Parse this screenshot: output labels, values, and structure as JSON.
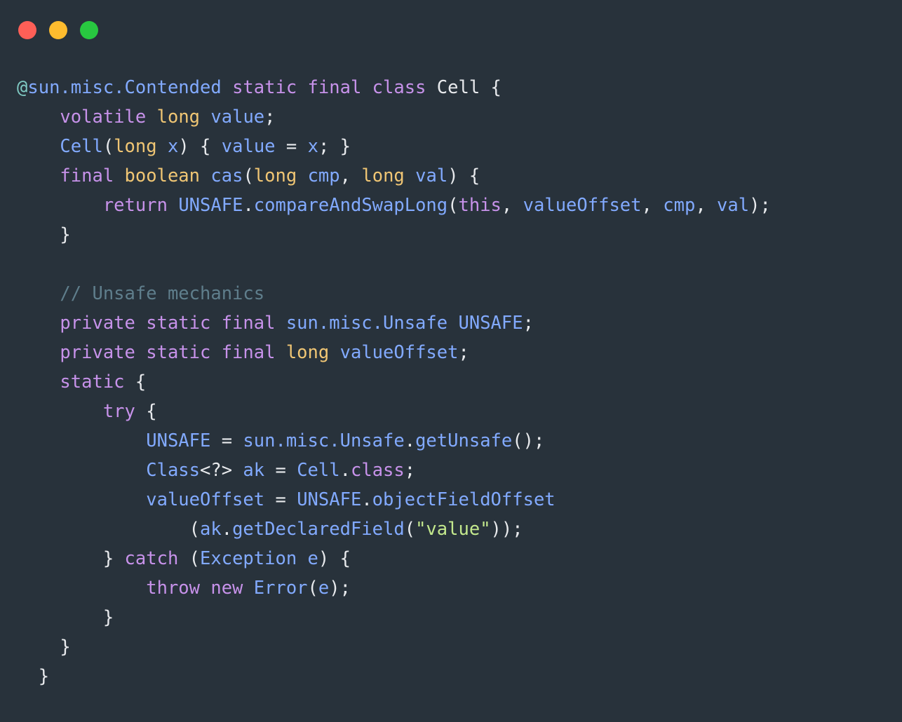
{
  "window": {
    "kind": "code-snippet-window",
    "background": "#28323b",
    "traffic_lights": [
      {
        "name": "close-button",
        "color": "#ff5f57",
        "label": "Close"
      },
      {
        "name": "minimize-button",
        "color": "#febc2e",
        "label": "Minimize"
      },
      {
        "name": "maximize-button",
        "color": "#28c840",
        "label": "Maximize"
      }
    ]
  },
  "editor": {
    "language": "Java",
    "font_size_px": 25.5,
    "line_height_px": 42,
    "theme_colors": {
      "background": "#28323b",
      "keyword": "#c792ea",
      "type": "#f0c674",
      "identifier": "#82aaff",
      "punctuation": "#e8eaed",
      "string": "#c3e88d",
      "comment": "#5f7e8c",
      "annotation": "#80cbc4"
    },
    "lines": [
      "@sun.misc.Contended static final class Cell {",
      "    volatile long value;",
      "    Cell(long x) { value = x; }",
      "    final boolean cas(long cmp, long val) {",
      "        return UNSAFE.compareAndSwapLong(this, valueOffset, cmp, val);",
      "    }",
      "",
      "    // Unsafe mechanics",
      "    private static final sun.misc.Unsafe UNSAFE;",
      "    private static final long valueOffset;",
      "    static {",
      "        try {",
      "            UNSAFE = sun.misc.Unsafe.getUnsafe();",
      "            Class<?> ak = Cell.class;",
      "            valueOffset = UNSAFE.objectFieldOffset",
      "                (ak.getDeclaredField(\"value\"));",
      "        } catch (Exception e) {",
      "            throw new Error(e);",
      "        }",
      "    }",
      "  }"
    ],
    "tokens": [
      [
        {
          "t": "@",
          "c": "ann"
        },
        {
          "t": "sun.misc.Contended",
          "c": "id"
        },
        {
          "t": " ",
          "c": "pun"
        },
        {
          "t": "static final class",
          "c": "kw"
        },
        {
          "t": " ",
          "c": "pun"
        },
        {
          "t": "Cell",
          "c": "pun"
        },
        {
          "t": " {",
          "c": "pun"
        }
      ],
      [
        {
          "t": "    ",
          "c": "pun"
        },
        {
          "t": "volatile",
          "c": "kw"
        },
        {
          "t": " ",
          "c": "pun"
        },
        {
          "t": "long",
          "c": "typ"
        },
        {
          "t": " ",
          "c": "pun"
        },
        {
          "t": "value",
          "c": "id"
        },
        {
          "t": ";",
          "c": "pun"
        }
      ],
      [
        {
          "t": "    ",
          "c": "pun"
        },
        {
          "t": "Cell",
          "c": "id"
        },
        {
          "t": "(",
          "c": "pun"
        },
        {
          "t": "long",
          "c": "typ"
        },
        {
          "t": " ",
          "c": "pun"
        },
        {
          "t": "x",
          "c": "id"
        },
        {
          "t": ") { ",
          "c": "pun"
        },
        {
          "t": "value",
          "c": "id"
        },
        {
          "t": " = ",
          "c": "pun"
        },
        {
          "t": "x",
          "c": "id"
        },
        {
          "t": "; }",
          "c": "pun"
        }
      ],
      [
        {
          "t": "    ",
          "c": "pun"
        },
        {
          "t": "final",
          "c": "kw"
        },
        {
          "t": " ",
          "c": "pun"
        },
        {
          "t": "boolean",
          "c": "typ"
        },
        {
          "t": " ",
          "c": "pun"
        },
        {
          "t": "cas",
          "c": "id"
        },
        {
          "t": "(",
          "c": "pun"
        },
        {
          "t": "long",
          "c": "typ"
        },
        {
          "t": " ",
          "c": "pun"
        },
        {
          "t": "cmp",
          "c": "id"
        },
        {
          "t": ", ",
          "c": "pun"
        },
        {
          "t": "long",
          "c": "typ"
        },
        {
          "t": " ",
          "c": "pun"
        },
        {
          "t": "val",
          "c": "id"
        },
        {
          "t": ") {",
          "c": "pun"
        }
      ],
      [
        {
          "t": "        ",
          "c": "pun"
        },
        {
          "t": "return",
          "c": "kw"
        },
        {
          "t": " ",
          "c": "pun"
        },
        {
          "t": "UNSAFE",
          "c": "id"
        },
        {
          "t": ".",
          "c": "pun"
        },
        {
          "t": "compareAndSwapLong",
          "c": "id"
        },
        {
          "t": "(",
          "c": "pun"
        },
        {
          "t": "this",
          "c": "kw"
        },
        {
          "t": ", ",
          "c": "pun"
        },
        {
          "t": "valueOffset",
          "c": "id"
        },
        {
          "t": ", ",
          "c": "pun"
        },
        {
          "t": "cmp",
          "c": "id"
        },
        {
          "t": ", ",
          "c": "pun"
        },
        {
          "t": "val",
          "c": "id"
        },
        {
          "t": ");",
          "c": "pun"
        }
      ],
      [
        {
          "t": "    }",
          "c": "pun"
        }
      ],
      [
        {
          "t": "",
          "c": "pun"
        }
      ],
      [
        {
          "t": "    ",
          "c": "pun"
        },
        {
          "t": "// Unsafe mechanics",
          "c": "cmt"
        }
      ],
      [
        {
          "t": "    ",
          "c": "pun"
        },
        {
          "t": "private static final",
          "c": "kw"
        },
        {
          "t": " ",
          "c": "pun"
        },
        {
          "t": "sun.misc.Unsafe",
          "c": "id"
        },
        {
          "t": " ",
          "c": "pun"
        },
        {
          "t": "UNSAFE",
          "c": "id"
        },
        {
          "t": ";",
          "c": "pun"
        }
      ],
      [
        {
          "t": "    ",
          "c": "pun"
        },
        {
          "t": "private static final",
          "c": "kw"
        },
        {
          "t": " ",
          "c": "pun"
        },
        {
          "t": "long",
          "c": "typ"
        },
        {
          "t": " ",
          "c": "pun"
        },
        {
          "t": "valueOffset",
          "c": "id"
        },
        {
          "t": ";",
          "c": "pun"
        }
      ],
      [
        {
          "t": "    ",
          "c": "pun"
        },
        {
          "t": "static",
          "c": "kw"
        },
        {
          "t": " {",
          "c": "pun"
        }
      ],
      [
        {
          "t": "        ",
          "c": "pun"
        },
        {
          "t": "try",
          "c": "kw"
        },
        {
          "t": " {",
          "c": "pun"
        }
      ],
      [
        {
          "t": "            ",
          "c": "pun"
        },
        {
          "t": "UNSAFE",
          "c": "id"
        },
        {
          "t": " = ",
          "c": "pun"
        },
        {
          "t": "sun.misc.Unsafe",
          "c": "id"
        },
        {
          "t": ".",
          "c": "pun"
        },
        {
          "t": "getUnsafe",
          "c": "id"
        },
        {
          "t": "();",
          "c": "pun"
        }
      ],
      [
        {
          "t": "            ",
          "c": "pun"
        },
        {
          "t": "Class",
          "c": "id"
        },
        {
          "t": "<?> ",
          "c": "pun"
        },
        {
          "t": "ak",
          "c": "id"
        },
        {
          "t": " = ",
          "c": "pun"
        },
        {
          "t": "Cell",
          "c": "id"
        },
        {
          "t": ".",
          "c": "pun"
        },
        {
          "t": "class",
          "c": "kw"
        },
        {
          "t": ";",
          "c": "pun"
        }
      ],
      [
        {
          "t": "            ",
          "c": "pun"
        },
        {
          "t": "valueOffset",
          "c": "id"
        },
        {
          "t": " = ",
          "c": "pun"
        },
        {
          "t": "UNSAFE",
          "c": "id"
        },
        {
          "t": ".",
          "c": "pun"
        },
        {
          "t": "objectFieldOffset",
          "c": "id"
        }
      ],
      [
        {
          "t": "                ",
          "c": "pun"
        },
        {
          "t": "(",
          "c": "pun"
        },
        {
          "t": "ak",
          "c": "id"
        },
        {
          "t": ".",
          "c": "pun"
        },
        {
          "t": "getDeclaredField",
          "c": "id"
        },
        {
          "t": "(",
          "c": "pun"
        },
        {
          "t": "\"value\"",
          "c": "str"
        },
        {
          "t": "));",
          "c": "pun"
        }
      ],
      [
        {
          "t": "        } ",
          "c": "pun"
        },
        {
          "t": "catch",
          "c": "kw"
        },
        {
          "t": " (",
          "c": "pun"
        },
        {
          "t": "Exception",
          "c": "id"
        },
        {
          "t": " ",
          "c": "pun"
        },
        {
          "t": "e",
          "c": "id"
        },
        {
          "t": ") {",
          "c": "pun"
        }
      ],
      [
        {
          "t": "            ",
          "c": "pun"
        },
        {
          "t": "throw new",
          "c": "kw"
        },
        {
          "t": " ",
          "c": "pun"
        },
        {
          "t": "Error",
          "c": "id"
        },
        {
          "t": "(",
          "c": "pun"
        },
        {
          "t": "e",
          "c": "id"
        },
        {
          "t": ");",
          "c": "pun"
        }
      ],
      [
        {
          "t": "        }",
          "c": "pun"
        }
      ],
      [
        {
          "t": "    }",
          "c": "pun"
        }
      ],
      [
        {
          "t": "  }",
          "c": "pun"
        }
      ]
    ]
  }
}
